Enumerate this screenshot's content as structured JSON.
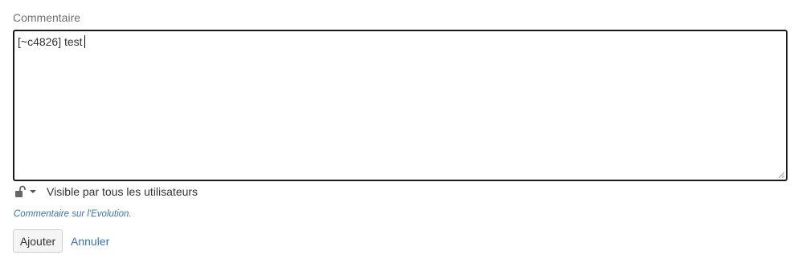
{
  "form": {
    "label": "Commentaire",
    "comment_value": "[~c4826] test",
    "visibility": {
      "icon": "unlock-icon",
      "text": "Visible par tous les utilisateurs"
    },
    "context_link": "Commentaire sur l'Evolution.",
    "submit_label": "Ajouter",
    "cancel_label": "Annuler"
  },
  "colors": {
    "link": "#3b73af",
    "label": "#707070",
    "focus_border": "#1a1a1a"
  }
}
